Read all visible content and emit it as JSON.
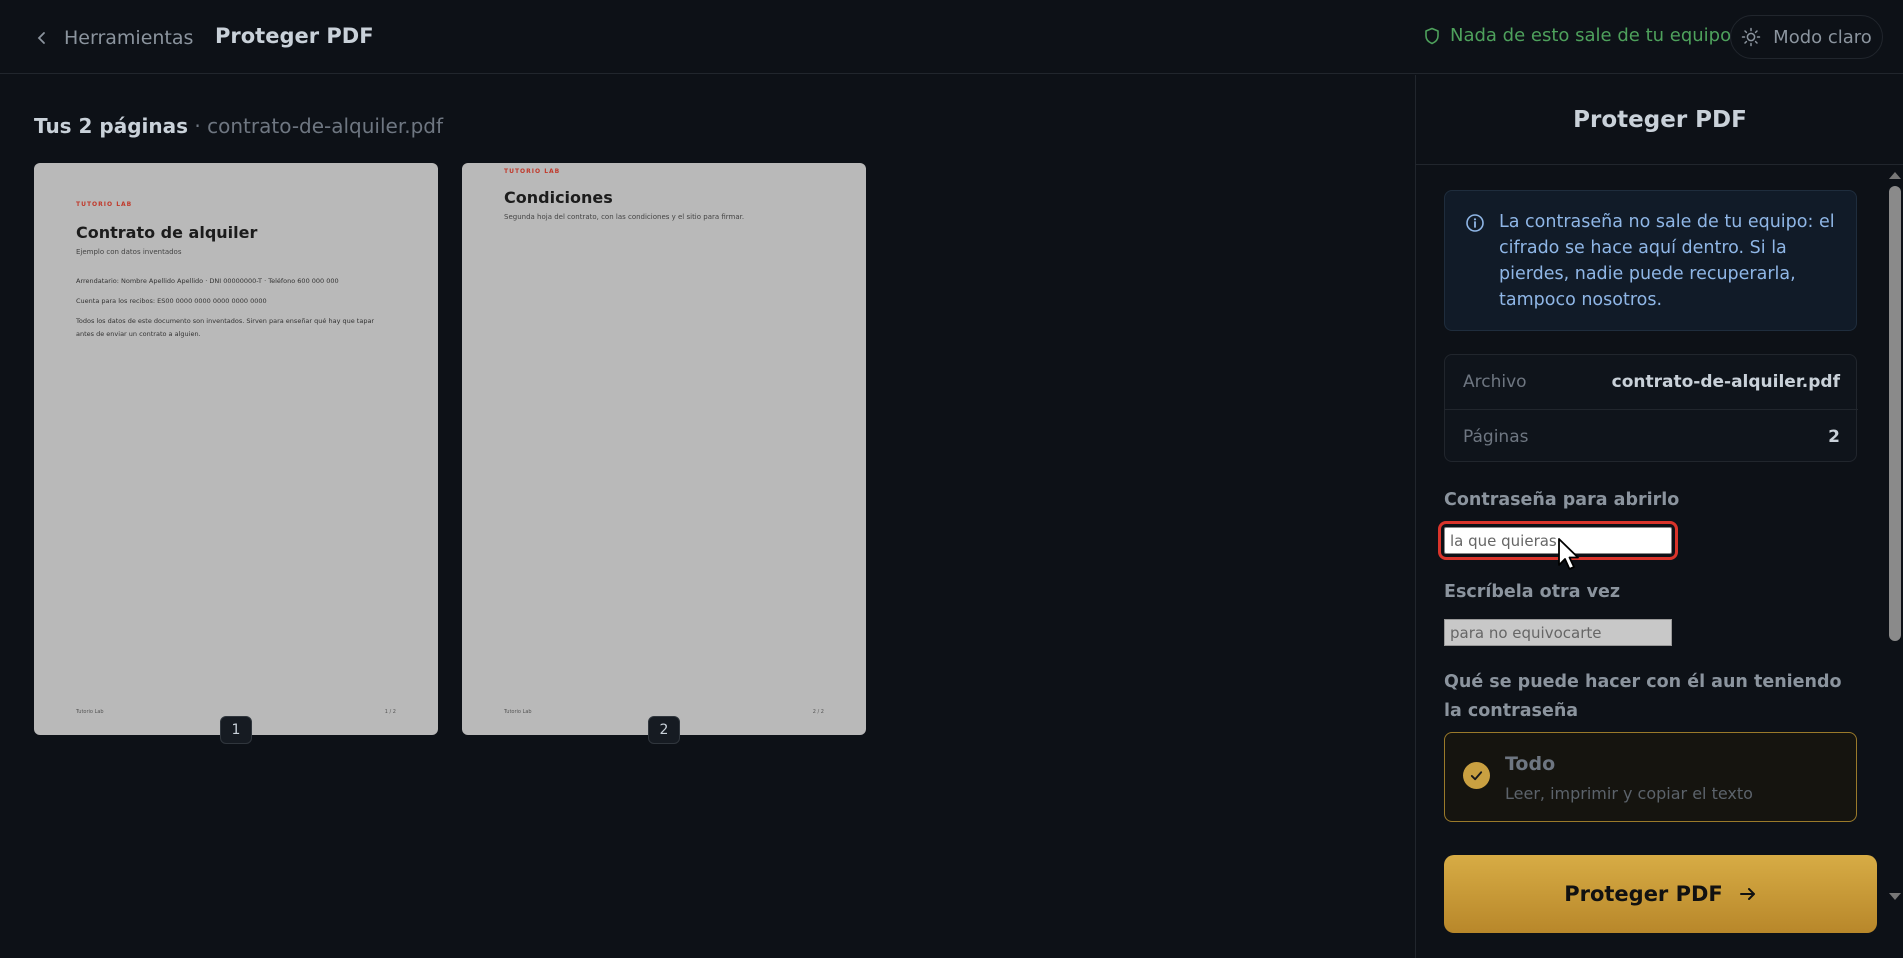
{
  "header": {
    "back_label": "Herramientas",
    "title": "Proteger PDF",
    "privacy_note": "Nada de esto sale de tu equipo",
    "mode_label": "Modo claro"
  },
  "main": {
    "heading_strong": "Tus 2 páginas",
    "heading_file": " · contrato-de-alquiler.pdf",
    "pages": [
      {
        "number": "1",
        "brand": "TUTORIO LAB",
        "title": "Contrato de alquiler",
        "subtitle": "Ejemplo con datos inventados",
        "lines": [
          "Arrendatario: Nombre Apellido Apellido · DNI 00000000-T · Teléfono 600 000 000",
          "Cuenta para los recibos: ES00 0000 0000 0000 0000 0000",
          "Todos los datos de este documento son inventados. Sirven para enseñar qué hay que tapar antes de enviar un contrato a alguien."
        ],
        "footer_left": "Tutorio Lab",
        "footer_right": "1 / 2"
      },
      {
        "number": "2",
        "brand": "TUTORIO LAB",
        "title": "Condiciones",
        "subtitle": "Segunda hoja del contrato, con las condiciones y el sitio para firmar.",
        "footer_left": "Tutorio Lab",
        "footer_right": "2 / 2"
      }
    ]
  },
  "panel": {
    "title": "Proteger PDF",
    "info": "La contraseña no sale de tu equipo: el cifrado se hace aquí dentro. Si la pierdes, nadie puede recuperarla, tampoco nosotros.",
    "meta": [
      {
        "key": "Archivo",
        "value": "contrato-de-alquiler.pdf"
      },
      {
        "key": "Páginas",
        "value": "2"
      }
    ],
    "password_label": "Contraseña para abrirlo",
    "password_placeholder": "la que quieras",
    "confirm_label": "Escríbela otra vez",
    "confirm_placeholder": "para no equivocarte",
    "permissions_label": "Qué se puede hacer con él aun teniendo la contraseña",
    "permission_option": {
      "title": "Todo",
      "subtitle": "Leer, imprimir y copiar el texto",
      "selected": true
    },
    "cta_label": "Proteger PDF"
  },
  "colors": {
    "background": "#0d1117",
    "accent_gold": "#c9a041",
    "privacy_green": "#4ea15c",
    "info_blue": "#8fb6e6",
    "focus_red": "#d9342b"
  }
}
